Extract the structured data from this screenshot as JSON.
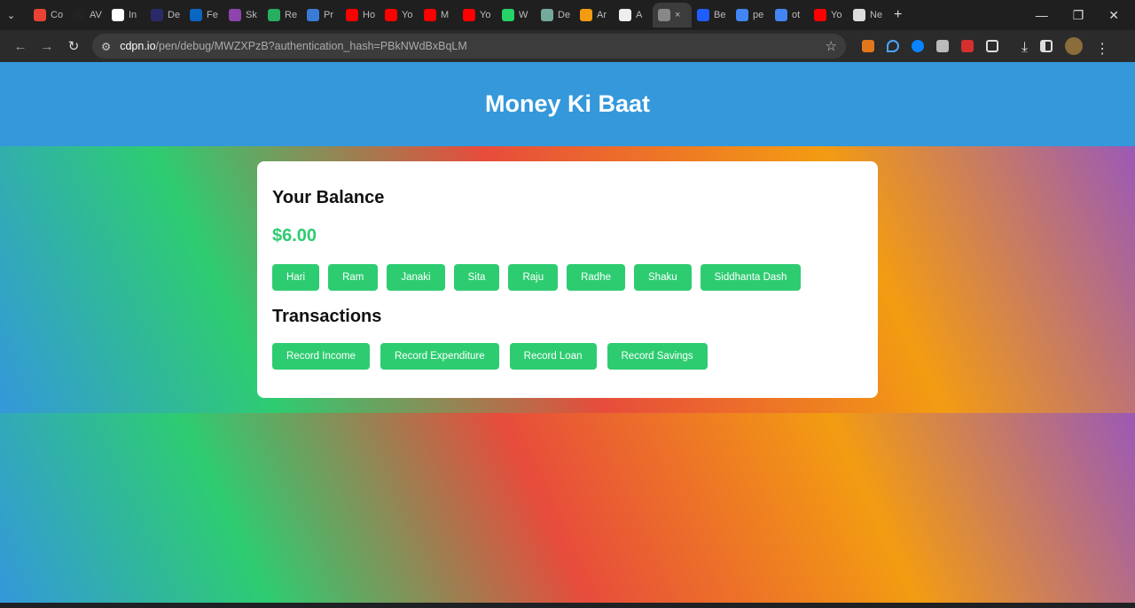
{
  "browser": {
    "tabs": [
      {
        "label": "Co",
        "color": "#ea4335"
      },
      {
        "label": "AV",
        "color": "#222"
      },
      {
        "label": "In",
        "color": "#fff"
      },
      {
        "label": "De",
        "color": "#2a2a6a"
      },
      {
        "label": "Fe",
        "color": "#0a66c2"
      },
      {
        "label": "Sk",
        "color": "#8e44ad"
      },
      {
        "label": "Re",
        "color": "#27ae60"
      },
      {
        "label": "Pr",
        "color": "#3a7bd5"
      },
      {
        "label": "Ho",
        "color": "#ff0000"
      },
      {
        "label": "Yo",
        "color": "#ff0000"
      },
      {
        "label": "M",
        "color": "#ff0000"
      },
      {
        "label": "Yo",
        "color": "#ff0000"
      },
      {
        "label": "W",
        "color": "#25d366"
      },
      {
        "label": "De",
        "color": "#74aa9c"
      },
      {
        "label": "Ar",
        "color": "#f39c12"
      },
      {
        "label": "A",
        "color": "#eee"
      },
      {
        "label": "×",
        "color": "#888",
        "active": true
      },
      {
        "label": "Be",
        "color": "#1e5eff"
      },
      {
        "label": "pe",
        "color": "#4285f4"
      },
      {
        "label": "ot",
        "color": "#4285f4"
      },
      {
        "label": "Yo",
        "color": "#ff0000"
      },
      {
        "label": "Ne",
        "color": "#ddd"
      }
    ],
    "new_tab": "+",
    "url_host": "cdpn.io",
    "url_path": "/pen/debug/MWZXPzB?authentication_hash=PBkNWdBxBqLM"
  },
  "app": {
    "title": "Money Ki Baat",
    "balance_heading": "Your Balance",
    "balance": "$6.00",
    "people": [
      "Hari",
      "Ram",
      "Janaki",
      "Sita",
      "Raju",
      "Radhe",
      "Shaku",
      "Siddhanta Dash"
    ],
    "transactions_heading": "Transactions",
    "actions": [
      "Record Income",
      "Record Expenditure",
      "Record Loan",
      "Record Savings"
    ]
  }
}
